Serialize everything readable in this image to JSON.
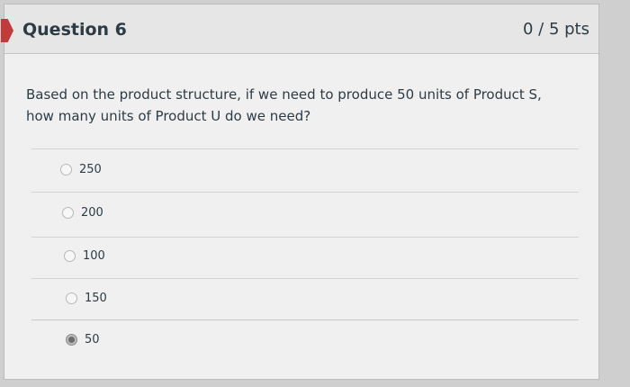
{
  "question": {
    "title": "Question 6",
    "points": "0 / 5 pts",
    "text": "Based on the product structure, if we need to produce 50 units of Product S, how many units of Product U do we need?"
  },
  "answers": [
    {
      "label": "250",
      "selected": false
    },
    {
      "label": "200",
      "selected": false
    },
    {
      "label": "100",
      "selected": false
    },
    {
      "label": "150",
      "selected": false
    },
    {
      "label": "50",
      "selected": true
    }
  ],
  "colors": {
    "incorrect_flag": "#c23b3b",
    "text": "#2d3b45"
  }
}
